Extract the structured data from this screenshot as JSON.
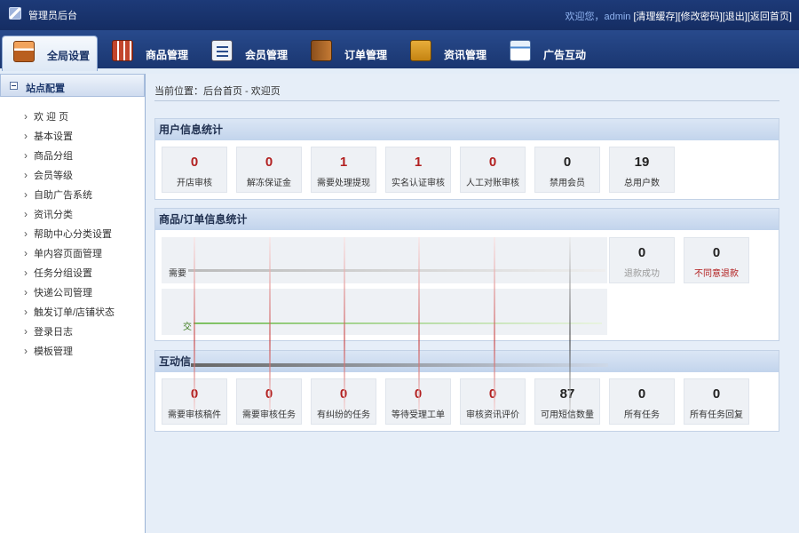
{
  "app": {
    "title": "管理员后台",
    "welcome": "欢迎您，admin",
    "links": [
      "[清理缓存]",
      "[修改密码]",
      "[退出]",
      "[返回首页]"
    ]
  },
  "nav": {
    "tabs": [
      {
        "label": "全局设置",
        "icon": "global-settings-icon",
        "active": true
      },
      {
        "label": "商品管理",
        "icon": "goods-icon"
      },
      {
        "label": "会员管理",
        "icon": "member-icon"
      },
      {
        "label": "订单管理",
        "icon": "order-icon"
      },
      {
        "label": "资讯管理",
        "icon": "news-icon"
      },
      {
        "label": "广告互动",
        "icon": "ad-icon"
      }
    ]
  },
  "sidebar": {
    "heading": "站点配置",
    "items": [
      "欢 迎 页",
      "基本设置",
      "商品分组",
      "会员等级",
      "自助广告系统",
      "资讯分类",
      "帮助中心分类设置",
      "单内容页面管理",
      "任务分组设置",
      "快递公司管理",
      "触发订单/店铺状态",
      "登录日志",
      "模板管理"
    ]
  },
  "breadcrumb": "当前位置：后台首页 - 欢迎页",
  "user_stats": {
    "title": "用户信息统计",
    "cards": [
      {
        "value": "0",
        "label": "开店审核",
        "red": true
      },
      {
        "value": "0",
        "label": "解冻保证金",
        "red": true
      },
      {
        "value": "1",
        "label": "需要处理提现",
        "red": true
      },
      {
        "value": "1",
        "label": "实名认证审核",
        "red": true
      },
      {
        "value": "0",
        "label": "人工对账审核",
        "red": true
      },
      {
        "value": "0",
        "label": "禁用会员",
        "red": false
      },
      {
        "value": "19",
        "label": "总用户数",
        "red": false
      }
    ]
  },
  "order_stats": {
    "title": "商品/订单信息统计",
    "partial_labels": [
      "需要",
      "交"
    ],
    "cards": [
      {
        "value": "0",
        "label": "退款成功",
        "style": "muted"
      },
      {
        "value": "0",
        "label": "不同意退款",
        "style": "alert"
      }
    ]
  },
  "interact_stats": {
    "title": "互动信",
    "cards": [
      {
        "value": "0",
        "label": "需要审核稿件",
        "red": true
      },
      {
        "value": "0",
        "label": "需要审核任务",
        "red": true
      },
      {
        "value": "0",
        "label": "有纠纷的任务",
        "red": true
      },
      {
        "value": "0",
        "label": "等待受理工单",
        "red": true
      },
      {
        "value": "0",
        "label": "审核资讯评价",
        "red": true
      },
      {
        "value": "87",
        "label": "可用短信数量",
        "red": false
      },
      {
        "value": "0",
        "label": "所有任务",
        "red": false
      },
      {
        "value": "0",
        "label": "所有任务回复",
        "red": false
      }
    ]
  },
  "colors": {
    "accent_red": "#b22020",
    "header_blue": "#1d3a78"
  }
}
